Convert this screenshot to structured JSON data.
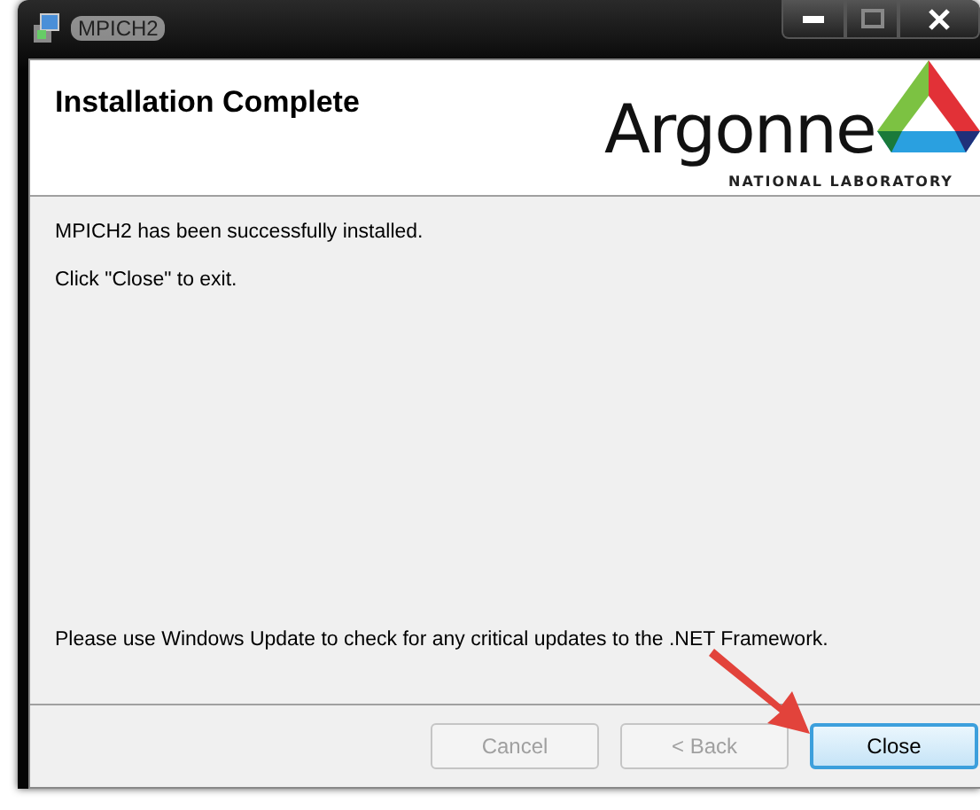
{
  "window": {
    "title": "MPICH2"
  },
  "header": {
    "title": "Installation Complete",
    "logo": {
      "wordmark": "Argonne",
      "subtitle": "NATIONAL LABORATORY"
    }
  },
  "messages": [
    "MPICH2 has been successfully installed.",
    "Click \"Close\" to exit."
  ],
  "footnote": "Please use Windows Update to check for any critical updates to the .NET Framework.",
  "buttons": [
    {
      "label": "Cancel",
      "disabled": true,
      "default": false
    },
    {
      "label": "< Back",
      "disabled": true,
      "default": false
    },
    {
      "label": "Close",
      "disabled": false,
      "default": true
    }
  ]
}
